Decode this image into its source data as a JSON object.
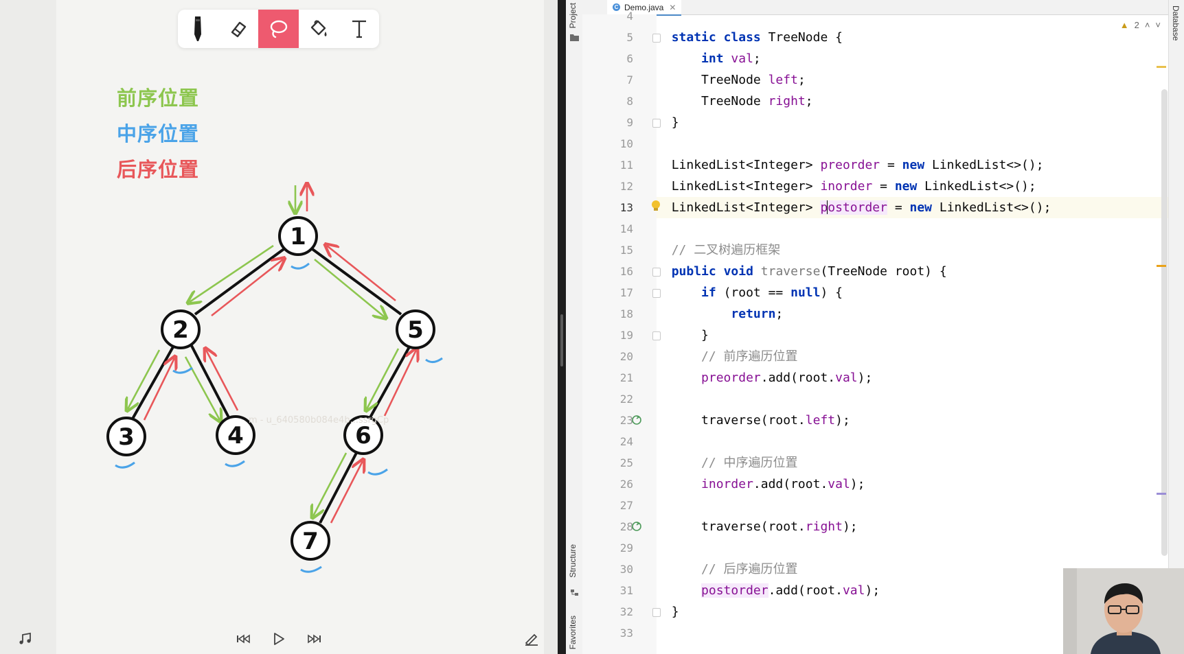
{
  "drawing_app": {
    "toolbar": {
      "tools": [
        {
          "name": "pen",
          "icon": "pen-icon",
          "active": false
        },
        {
          "name": "eraser",
          "icon": "eraser-icon",
          "active": false
        },
        {
          "name": "lasso",
          "icon": "lasso-icon",
          "active": true
        },
        {
          "name": "fill",
          "icon": "paint-bucket-icon",
          "active": false
        },
        {
          "name": "text",
          "icon": "text-tool-icon",
          "active": false
        }
      ]
    },
    "legend": [
      {
        "label": "前序位置",
        "color": "#8dc64f"
      },
      {
        "label": "中序位置",
        "color": "#4aa3e8"
      },
      {
        "label": "后序位置",
        "color": "#e8575a"
      }
    ],
    "tree": {
      "nodes": [
        "1",
        "2",
        "5",
        "3",
        "4",
        "6",
        "7"
      ],
      "edges": [
        [
          "1",
          "2"
        ],
        [
          "1",
          "5"
        ],
        [
          "2",
          "3"
        ],
        [
          "2",
          "4"
        ],
        [
          "5",
          "6"
        ],
        [
          "6",
          "7"
        ]
      ]
    },
    "watermark": "m - u_640580b084e4b...ssrgCp",
    "playback": {
      "icons": [
        "music-icon",
        "skip-back-icon",
        "play-icon",
        "skip-forward-icon",
        "annotate-icon"
      ]
    }
  },
  "ide": {
    "left_panels": [
      "Project",
      "Structure",
      "Favorites"
    ],
    "right_panels": [
      "Database"
    ],
    "tab": {
      "filename": "Demo.java",
      "icon_letter": "C"
    },
    "inspections": {
      "warnings": "2"
    },
    "current_line": "13",
    "line_numbers": [
      "4",
      "5",
      "6",
      "7",
      "8",
      "9",
      "10",
      "11",
      "12",
      "13",
      "14",
      "15",
      "16",
      "17",
      "18",
      "19",
      "20",
      "21",
      "22",
      "23",
      "24",
      "25",
      "26",
      "27",
      "28",
      "29",
      "30",
      "31",
      "32",
      "33"
    ],
    "code": {
      "l5": {
        "kw1": "static",
        "kw2": "class",
        "rest": " TreeNode {"
      },
      "l6": {
        "kw": "int",
        "field": "val",
        "rest": ";"
      },
      "l7": {
        "type": "TreeNode ",
        "field": "left",
        "rest": ";"
      },
      "l8": {
        "type": "TreeNode ",
        "field": "right",
        "rest": ";"
      },
      "l9": {
        "text": "}"
      },
      "l11": {
        "type": "LinkedList<Integer> ",
        "field": "preorder",
        "eq": " = ",
        "kw": "new",
        "rest": " LinkedList<>();"
      },
      "l12": {
        "type": "LinkedList<Integer> ",
        "field": "inorder",
        "eq": " = ",
        "kw": "new",
        "rest": " LinkedList<>();"
      },
      "l13": {
        "type": "LinkedList<Integer> ",
        "field_a": "p",
        "field_b": "ostorder",
        "eq": " = ",
        "kw": "new",
        "rest": " LinkedList<>();"
      },
      "l15": {
        "comment": "// 二叉树遍历框架"
      },
      "l16": {
        "kw1": "public",
        "kw2": "void",
        "fn": "traverse",
        "rest": "(TreeNode root) {"
      },
      "l17": {
        "kw": "if",
        "mid": " (root == ",
        "kw2": "null",
        "rest": ") {"
      },
      "l18": {
        "kw": "return",
        "rest": ";"
      },
      "l19": {
        "text": "}"
      },
      "l20": {
        "comment": "// 前序遍历位置"
      },
      "l21": {
        "field": "preorder",
        "mid": ".add(root.",
        "field2": "val",
        "rest": ");"
      },
      "l23": {
        "text": "traverse(root.",
        "field": "left",
        "rest": ");"
      },
      "l25": {
        "comment": "// 中序遍历位置"
      },
      "l26": {
        "field": "inorder",
        "mid": ".add(root.",
        "field2": "val",
        "rest": ");"
      },
      "l28": {
        "text": "traverse(root.",
        "field": "right",
        "rest": ");"
      },
      "l30": {
        "comment": "// 后序遍历位置"
      },
      "l31": {
        "field": "postorder",
        "mid": ".add(root.",
        "field2": "val",
        "rest": ");"
      },
      "l32": {
        "text": "}"
      }
    }
  }
}
